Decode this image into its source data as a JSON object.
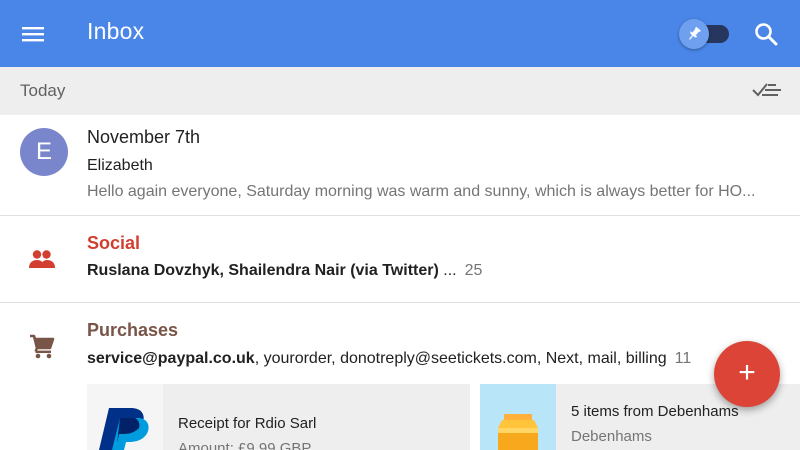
{
  "app_bar": {
    "title": "Inbox",
    "color": "#4a86e8",
    "menu_icon": "menu-icon",
    "pin_toggle_icon": "pin-icon",
    "search_icon": "search-icon"
  },
  "section": {
    "label": "Today",
    "sweep_icon": "sweep-done-icon"
  },
  "email": {
    "avatar_letter": "E",
    "avatar_color": "#7986cb",
    "subject": "November 7th",
    "sender": "Elizabeth",
    "snippet": "Hello again everyone, Saturday morning was warm and sunny, which is always better for HO..."
  },
  "social_bundle": {
    "title": "Social",
    "title_color": "#d23f31",
    "icon": "people-icon",
    "senders_bold": "Ruslana Dovzhyk, Shailendra Nair (via Twitter)",
    "ellipsis": " ...",
    "count": "25"
  },
  "purchases_bundle": {
    "title": "Purchases",
    "title_color": "#795548",
    "icon": "cart-icon",
    "senders_bold": "service@paypal.co.uk",
    "senders_rest": ", yourorder, donotreply@seetickets.com, Next, mail, billing",
    "count": "11",
    "cards": [
      {
        "title": "Receipt for Rdio Sarl",
        "subtitle": "Amount: £9.99 GBP",
        "thumb_icon": "paypal-logo-icon"
      },
      {
        "title": "5 items from Debenhams",
        "subtitle": "Debenhams",
        "thumb_icon": "package-icon"
      }
    ]
  },
  "fab": {
    "label": "+",
    "color": "#db4437"
  }
}
